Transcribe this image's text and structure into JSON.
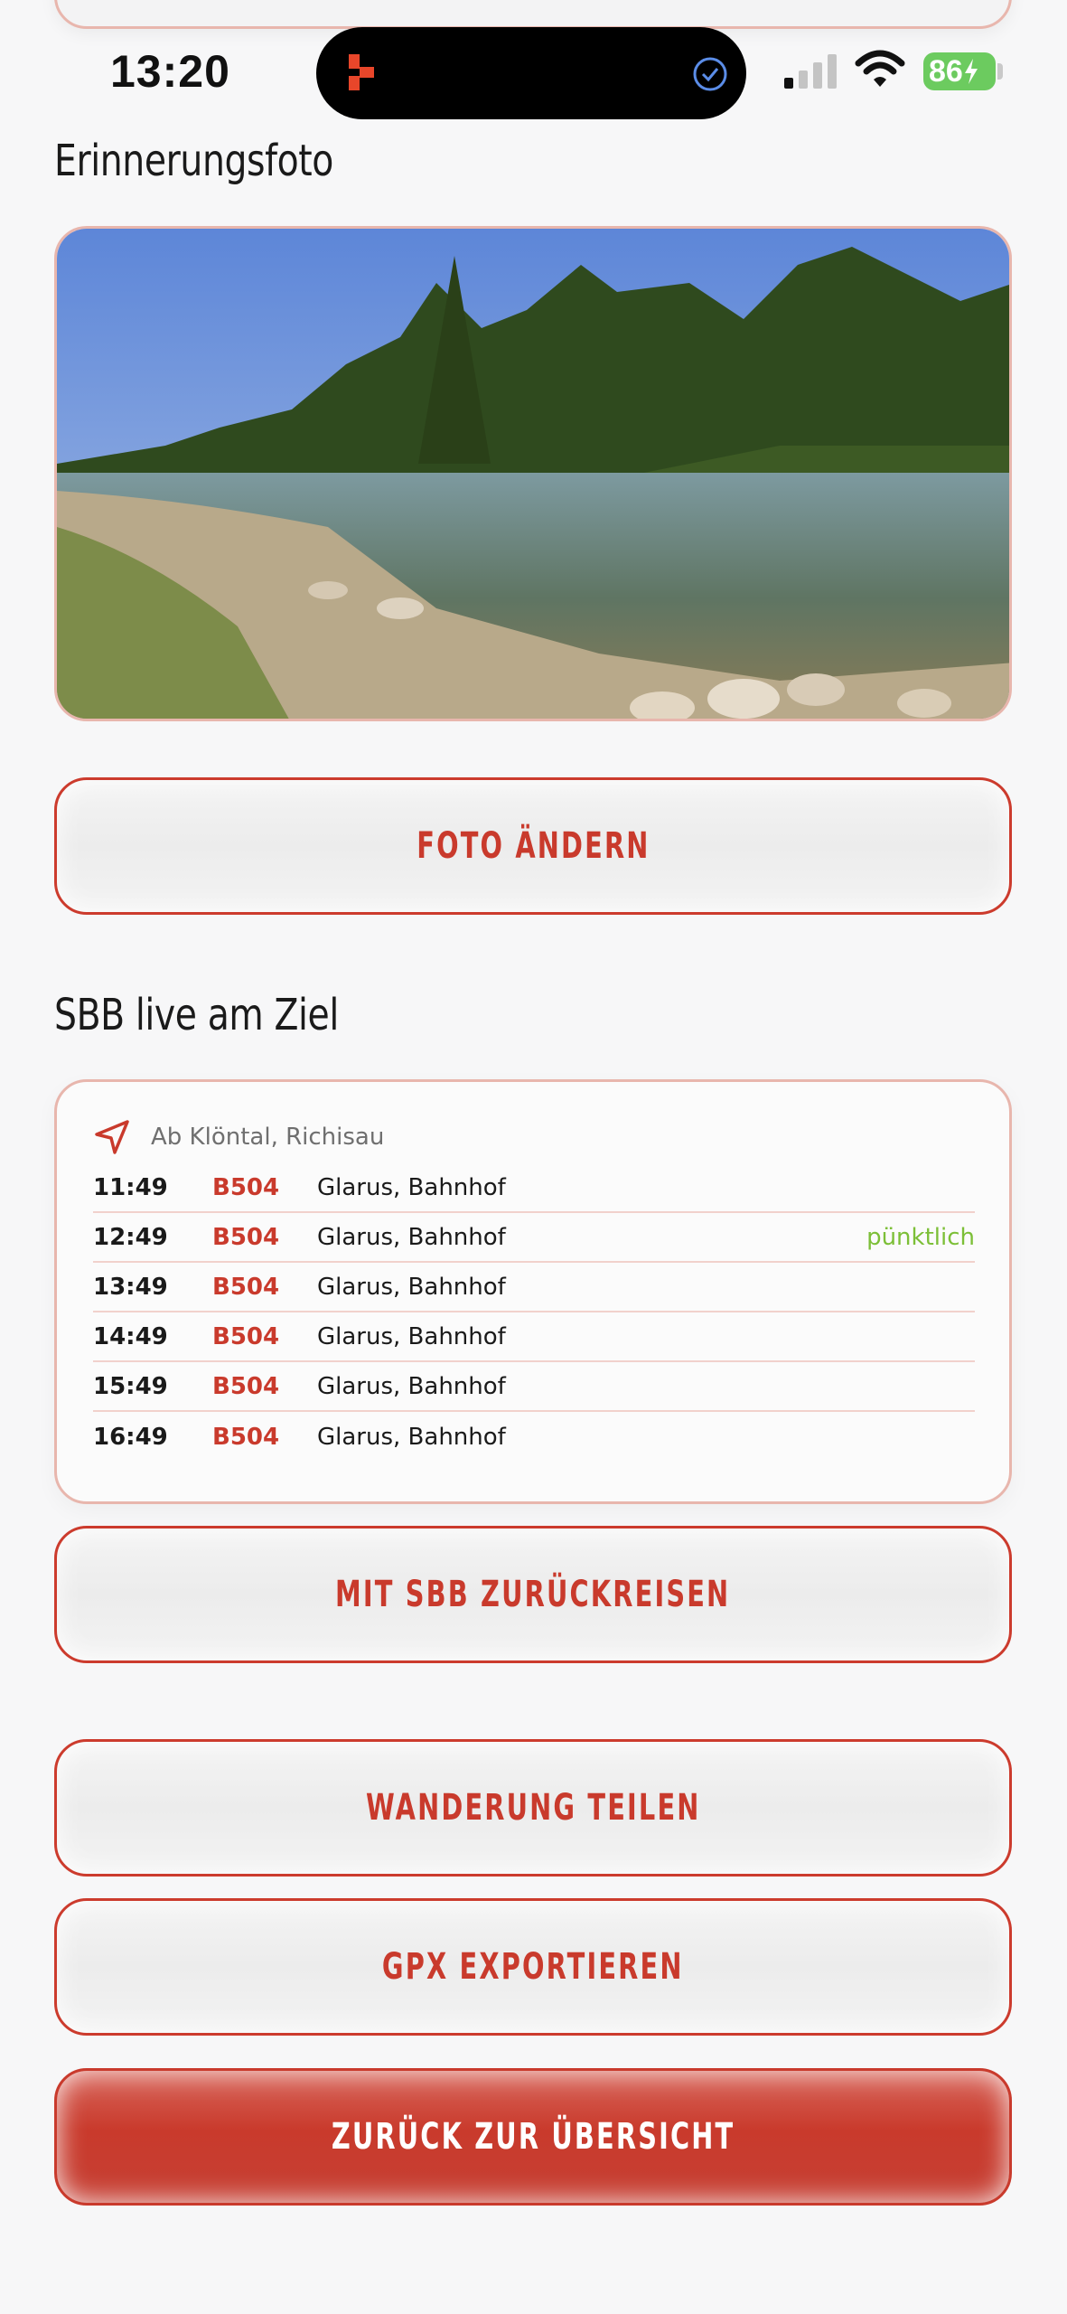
{
  "status_bar": {
    "time": "13:20",
    "battery": "86"
  },
  "photo_section": {
    "title": "Erinnerungsfoto",
    "change_button": "FOTO ÄNDERN"
  },
  "sbb_section": {
    "title": "SBB live am Ziel",
    "origin": "Ab Klöntal, Richisau",
    "departures": [
      {
        "time": "11:49",
        "line": "B504",
        "destination": "Glarus, Bahnhof",
        "status": ""
      },
      {
        "time": "12:49",
        "line": "B504",
        "destination": "Glarus, Bahnhof",
        "status": "pünktlich"
      },
      {
        "time": "13:49",
        "line": "B504",
        "destination": "Glarus, Bahnhof",
        "status": ""
      },
      {
        "time": "14:49",
        "line": "B504",
        "destination": "Glarus, Bahnhof",
        "status": ""
      },
      {
        "time": "15:49",
        "line": "B504",
        "destination": "Glarus, Bahnhof",
        "status": ""
      },
      {
        "time": "16:49",
        "line": "B504",
        "destination": "Glarus, Bahnhof",
        "status": ""
      }
    ],
    "return_button": "MIT SBB ZURÜCKREISEN"
  },
  "actions": {
    "share": "WANDERUNG TEILEN",
    "gpx": "GPX EXPORTIEREN",
    "back": "ZURÜCK ZUR ÜBERSICHT"
  },
  "colors": {
    "accent": "#c93a2c",
    "on_time": "#7cbf37",
    "card_border": "#e8b6ad"
  }
}
